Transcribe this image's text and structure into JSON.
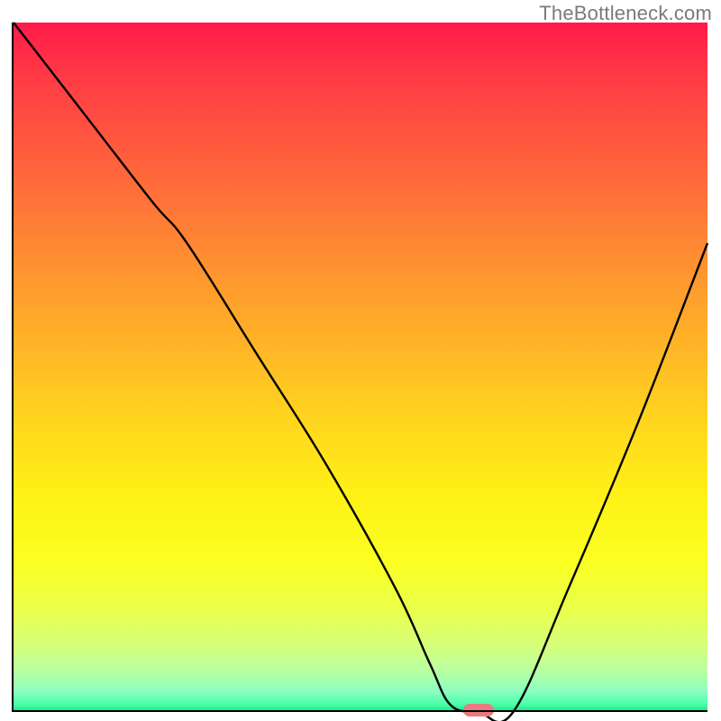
{
  "watermark": "TheBottleneck.com",
  "chart_data": {
    "type": "line",
    "title": "",
    "xlabel": "",
    "ylabel": "",
    "xlim": [
      0,
      100
    ],
    "ylim": [
      0,
      100
    ],
    "grid": false,
    "legend": false,
    "background_gradient": {
      "top_color": "#ff1a4a",
      "bottom_color": "#10e080",
      "description": "vertical gradient red→orange→yellow→green"
    },
    "series": [
      {
        "name": "bottleneck-curve",
        "color": "#000000",
        "x": [
          0,
          10,
          20,
          25,
          35,
          45,
          55,
          60,
          63,
          67,
          72,
          80,
          90,
          100
        ],
        "y": [
          100,
          87,
          74,
          68,
          52,
          36,
          18,
          7,
          1,
          0,
          0,
          18,
          42,
          68
        ]
      }
    ],
    "marker": {
      "name": "optimum-marker",
      "color": "#e97a7f",
      "x": 67,
      "y": 0,
      "width_pct": 4.4
    }
  }
}
